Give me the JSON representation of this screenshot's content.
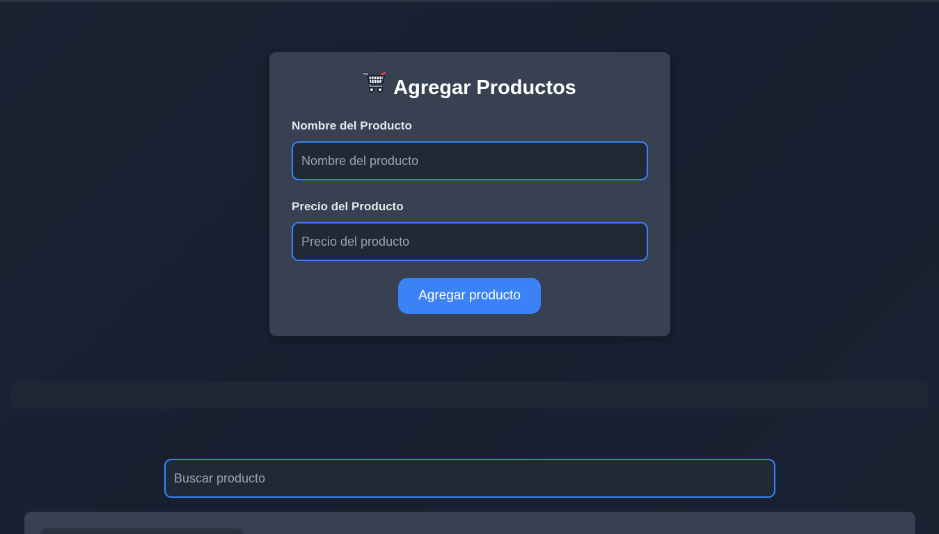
{
  "form": {
    "title": "Agregar Productos",
    "title_icon": "shopping-cart-icon",
    "name_label": "Nombre del Producto",
    "name_placeholder": "Nombre del producto",
    "price_label": "Precio del Producto",
    "price_placeholder": "Precio del producto",
    "submit_label": "Agregar producto"
  },
  "search": {
    "placeholder": "Buscar producto"
  },
  "colors": {
    "background": "#172030",
    "card": "#374151",
    "input_background": "#1f2937",
    "accent": "#3b82f6",
    "text": "#ffffff"
  }
}
